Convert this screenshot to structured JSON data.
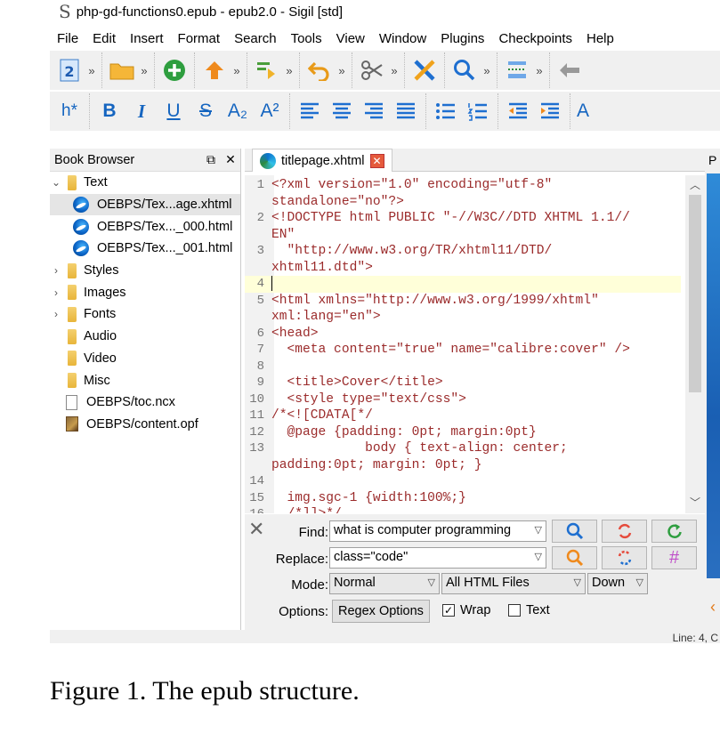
{
  "window": {
    "title": "php-gd-functions0.epub - epub2.0 - Sigil [std]"
  },
  "menu": [
    "File",
    "Edit",
    "Insert",
    "Format",
    "Search",
    "Tools",
    "View",
    "Window",
    "Plugins",
    "Checkpoints",
    "Help"
  ],
  "toolbar_format": {
    "heading": "h*",
    "bold": "B",
    "italic": "I",
    "underline": "U",
    "strike": "S",
    "subscript": "A₂",
    "superscript": "A²"
  },
  "book_browser": {
    "title": "Book Browser",
    "items": [
      {
        "label": "Text",
        "kind": "folder",
        "expanded": true,
        "level": 0
      },
      {
        "label": "OEBPS/Tex...age.xhtml",
        "kind": "html",
        "level": 1,
        "selected": true
      },
      {
        "label": "OEBPS/Tex..._000.html",
        "kind": "html",
        "level": 1
      },
      {
        "label": "OEBPS/Tex..._001.html",
        "kind": "html",
        "level": 1
      },
      {
        "label": "Styles",
        "kind": "folder",
        "expanded": false,
        "level": 0
      },
      {
        "label": "Images",
        "kind": "folder",
        "expanded": false,
        "level": 0
      },
      {
        "label": "Fonts",
        "kind": "folder",
        "expanded": false,
        "level": 0
      },
      {
        "label": "Audio",
        "kind": "folder",
        "level": 0
      },
      {
        "label": "Video",
        "kind": "folder",
        "level": 0
      },
      {
        "label": "Misc",
        "kind": "folder",
        "level": 0
      },
      {
        "label": "OEBPS/toc.ncx",
        "kind": "doc",
        "level": 0
      },
      {
        "label": "OEBPS/content.opf",
        "kind": "opf",
        "level": 0
      }
    ]
  },
  "editor": {
    "tab_label": "titlepage.xhtml",
    "current_line": 4,
    "lines": [
      {
        "n": "1",
        "text": "<?xml version=\"1.0\" encoding=\"utf-8\""
      },
      {
        "n": "",
        "text": "standalone=\"no\"?>"
      },
      {
        "n": "2",
        "text": "<!DOCTYPE html PUBLIC \"-//W3C//DTD XHTML 1.1//"
      },
      {
        "n": "",
        "text": "EN\""
      },
      {
        "n": "3",
        "text": "  \"http://www.w3.org/TR/xhtml11/DTD/"
      },
      {
        "n": "",
        "text": "xhtml11.dtd\">"
      },
      {
        "n": "4",
        "text": ""
      },
      {
        "n": "5",
        "text": "<html xmlns=\"http://www.w3.org/1999/xhtml\""
      },
      {
        "n": "",
        "text": "xml:lang=\"en\">"
      },
      {
        "n": "6",
        "text": "<head>"
      },
      {
        "n": "7",
        "text": "  <meta content=\"true\" name=\"calibre:cover\" />"
      },
      {
        "n": "8",
        "text": ""
      },
      {
        "n": "9",
        "text": "  <title>Cover</title>"
      },
      {
        "n": "10",
        "text": "  <style type=\"text/css\">"
      },
      {
        "n": "11",
        "text": "/*<![CDATA[*/"
      },
      {
        "n": "12",
        "text": "  @page {padding: 0pt; margin:0pt}"
      },
      {
        "n": "13",
        "text": "            body { text-align: center;"
      },
      {
        "n": "",
        "text": "padding:0pt; margin: 0pt; }"
      },
      {
        "n": "14",
        "text": ""
      },
      {
        "n": "15",
        "text": "  img.sgc-1 {width:100%;}"
      },
      {
        "n": "16",
        "text": "  /*]]>*/"
      }
    ]
  },
  "find_replace": {
    "find_label": "Find:",
    "find_value": "what is computer programming",
    "replace_label": "Replace:",
    "replace_value": "class=\"code\"",
    "mode_label": "Mode:",
    "mode_value": "Normal",
    "scope_value": "All HTML Files",
    "direction_value": "Down",
    "options_label": "Options:",
    "regex_options": "Regex Options",
    "wrap_label": "Wrap",
    "wrap_checked": true,
    "text_label": "Text",
    "text_checked": false
  },
  "right_panel": {
    "header": "P"
  },
  "status": {
    "text": "Line: 4, C"
  },
  "caption": "Figure 1. The epub structure."
}
